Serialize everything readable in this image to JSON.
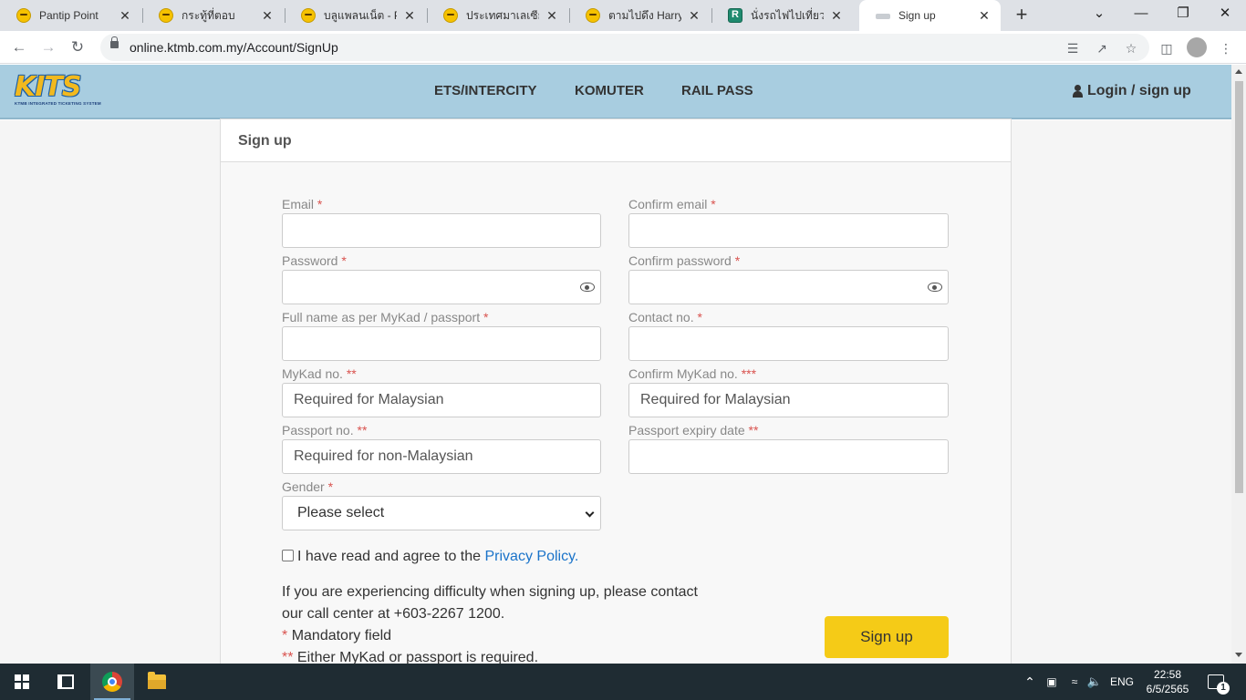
{
  "browser": {
    "tabs": [
      {
        "title": "Pantip Point",
        "icon": "pantip-face-icon"
      },
      {
        "title": "กระทู้ที่ตอบ",
        "icon": "pantip-face-icon"
      },
      {
        "title": "บลูแพลนเน็ต - Pant",
        "icon": "pantip-face-icon"
      },
      {
        "title": "ประเทศมาเลเซีย - P",
        "icon": "pantip-face-icon"
      },
      {
        "title": "ตามไปดึง Harry Po",
        "icon": "pantip-face-icon"
      },
      {
        "title": "นั่งรถไฟไปเที่ยวปีนัง",
        "icon": "r-app-icon"
      },
      {
        "title": "Sign up",
        "icon": "train-icon"
      }
    ],
    "tab_close_glyph": "✕",
    "new_tab_glyph": "+",
    "url": "online.ktmb.com.my/Account/SignUp",
    "window_controls": {
      "tabsearch": "⌄",
      "minimize": "—",
      "restore": "❐",
      "close": "✕"
    }
  },
  "site": {
    "logo_text": "KITS",
    "logo_subtitle": "KTMB INTEGRATED TICKETING SYSTEM",
    "nav": [
      "ETS/INTERCITY",
      "KOMUTER",
      "RAIL PASS"
    ],
    "login_label": "Login / sign up"
  },
  "form": {
    "heading": "Sign up",
    "fields": {
      "email": {
        "label": "Email",
        "req": "*",
        "placeholder": ""
      },
      "confirm_email": {
        "label": "Confirm email",
        "req": "*",
        "placeholder": ""
      },
      "password": {
        "label": "Password",
        "req": "*",
        "placeholder": ""
      },
      "confirm_password": {
        "label": "Confirm password",
        "req": "*",
        "placeholder": ""
      },
      "full_name": {
        "label": "Full name as per MyKad / passport",
        "req": "*",
        "placeholder": ""
      },
      "contact": {
        "label": "Contact no.",
        "req": "*",
        "placeholder": ""
      },
      "mykad": {
        "label": "MyKad no.",
        "req": "**",
        "placeholder": "Required for Malaysian"
      },
      "confirm_mykad": {
        "label": "Confirm MyKad no.",
        "req": "***",
        "placeholder": "Required for Malaysian"
      },
      "passport": {
        "label": "Passport no.",
        "req": "**",
        "placeholder": "Required for non-Malaysian"
      },
      "passport_expiry": {
        "label": "Passport expiry date",
        "req": "**",
        "placeholder": ""
      },
      "gender": {
        "label": "Gender",
        "req": "*",
        "selected": "Please select"
      }
    },
    "agree_text": "I have read and agree to the",
    "privacy_link": "Privacy Policy.",
    "help_line1": "If you are experiencing difficulty when signing up, please contact",
    "help_line2": "our call center at +603-2267 1200.",
    "note1_mark": "*",
    "note1_text": "Mandatory field",
    "note2_mark": "**",
    "note2_text": "Either MyKad or passport is required.",
    "submit_label": "Sign up"
  },
  "taskbar": {
    "language": "ENG",
    "time": "22:58",
    "date": "6/5/2565",
    "notification_count": "1"
  },
  "colors": {
    "nav_bg": "#a8cde0",
    "accent_button": "#f5cb17",
    "required_mark": "#d9534f",
    "link": "#1a73c9"
  }
}
